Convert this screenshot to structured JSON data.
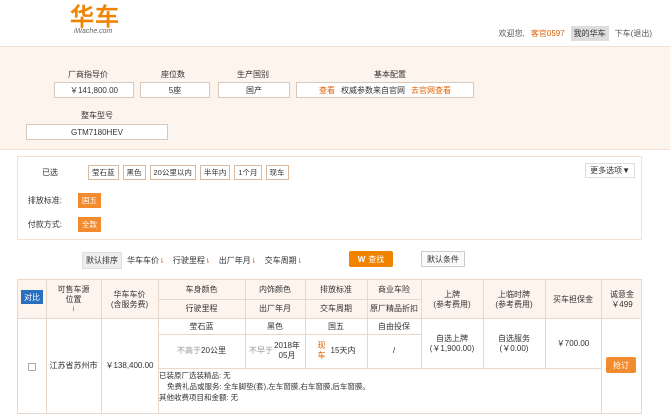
{
  "header": {
    "logo_cn": "华车",
    "logo_en": "iWache.com",
    "welcome": "欢迎您,",
    "user": "客官0597",
    "my_huache": "我的华车",
    "logout": "下车(退出)"
  },
  "car_info": {
    "price_label": "厂商指导价",
    "price_value": "￥141,800.00",
    "seats_label": "座位数",
    "seats_value": "5座",
    "origin_label": "生产国别",
    "origin_value": "国产",
    "config_label": "基本配置",
    "config_view": "查看",
    "config_note": "权威参数来自官网",
    "config_official": "去官网查看",
    "model_label": "整车型号",
    "model_value": "GTM7180HEV"
  },
  "filters": {
    "selected_label": "已选",
    "selected_tags": [
      "莹石蓝",
      "黑色",
      "20公里以内",
      "半年内",
      "1个月",
      "现车"
    ],
    "more_options": "更多选项▼",
    "emission_label": "排放标准:",
    "emission_tag": "国五",
    "payment_label": "付款方式:",
    "payment_tag": "全款"
  },
  "sort": {
    "default": "默认排序",
    "items": [
      "华车车价",
      "行驶里程",
      "出厂年月",
      "交车周期"
    ],
    "search_button": "查找",
    "reset_button": "默认条件"
  },
  "table": {
    "compare_button": "对比",
    "col_location": "可售车源位置",
    "col_price": "华车车价",
    "col_price_sub": "(含服务费)",
    "col_body_color": "车身颜色",
    "col_interior_color": "内饰颜色",
    "col_emission": "排放标准",
    "col_insurance": "商业车险",
    "col_mileage": "行驶里程",
    "col_factory_date": "出厂年月",
    "col_delivery": "交车周期",
    "col_accessories": "原厂精品折扣",
    "col_plate": "上牌",
    "col_plate_sub": "(参考费用)",
    "col_temp_plate": "上临时牌",
    "col_temp_plate_sub": "(参考费用)",
    "col_deposit": "买车担保金",
    "col_sincerity": "诚意金",
    "sincerity_value": "￥499",
    "row": {
      "location": "江苏省苏州市",
      "price": "￥138,400.00",
      "body_color": "莹石蓝",
      "interior_color": "黑色",
      "emission": "国五",
      "insurance": "自由投保",
      "mileage_prefix": "不高于",
      "mileage": "20公里",
      "date_prefix": "不早于",
      "date": "2018年05月",
      "delivery_tag": "现车",
      "delivery": "15天内",
      "accessories": "/",
      "plate_service": "自选上牌",
      "plate_fee": "(￥1,900.00)",
      "temp_service": "自选服务",
      "temp_fee": "(￥0.00)",
      "deposit": "￥700.00",
      "buy_button": "抢订",
      "extra_1": "已装原厂选装精品: 无",
      "extra_2": "免费礼品或服务: 全车脚垫(套),左车窗膜,右车窗膜,后车窗膜。",
      "extra_3": "其他收费项目和金额: 无"
    }
  }
}
